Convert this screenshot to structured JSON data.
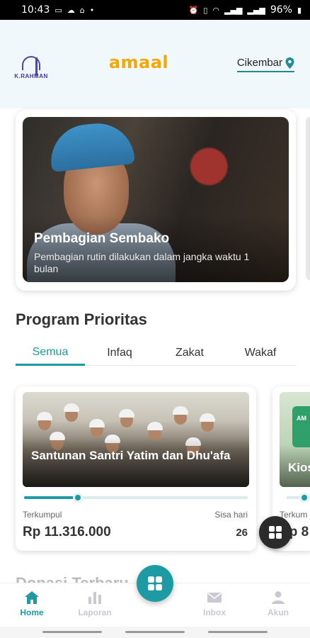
{
  "status_bar": {
    "time": "10:43",
    "battery": "96%",
    "left_icons": [
      "screen-icon",
      "cloud-icon",
      "mosque-icon",
      "dot-icon"
    ],
    "right_icons": [
      "alarm-icon",
      "vibrate-icon",
      "wifi-icon",
      "signal-icon",
      "signal-icon",
      "battery-icon"
    ]
  },
  "header": {
    "logo_text": "K.RAHMAN",
    "brand": "amaal",
    "location": "Cikembar",
    "location_icon": "map-pin-icon",
    "accent_color": "#1f9aa5",
    "brand_color": "#f6a800"
  },
  "banner": {
    "title": "Pembagian Sembako",
    "description": "Pembagian rutin dilakukan dalam jangka waktu 1 bulan"
  },
  "programs": {
    "section_title": "Program Prioritas",
    "tabs": [
      {
        "label": "Semua",
        "active": true
      },
      {
        "label": "Infaq",
        "active": false
      },
      {
        "label": "Zakat",
        "active": false
      },
      {
        "label": "Wakaf",
        "active": false
      }
    ],
    "cards": [
      {
        "title": "Santunan Santri Yatim dan Dhu'afa",
        "collected_label": "Terkumpul",
        "amount": "Rp 11.316.000",
        "remaining_label": "Sisa hari",
        "remaining_days": "26",
        "progress": 0.24
      },
      {
        "title": "Kios",
        "badge_text": "AM",
        "collected_label": "Terkum",
        "amount": "Rp 8"
      }
    ]
  },
  "next_section_title": "Donasi Terbaru",
  "bottom_nav": {
    "items": [
      {
        "label": "Home",
        "icon": "home-icon",
        "active": true
      },
      {
        "label": "Laporan",
        "icon": "bar-chart-icon",
        "active": false
      },
      {
        "label": "Inbox",
        "icon": "envelope-icon",
        "active": false
      },
      {
        "label": "Akun",
        "icon": "person-icon",
        "active": false
      }
    ],
    "center_icon": "grid-icon"
  },
  "floating_button_icon": "grid-icon"
}
